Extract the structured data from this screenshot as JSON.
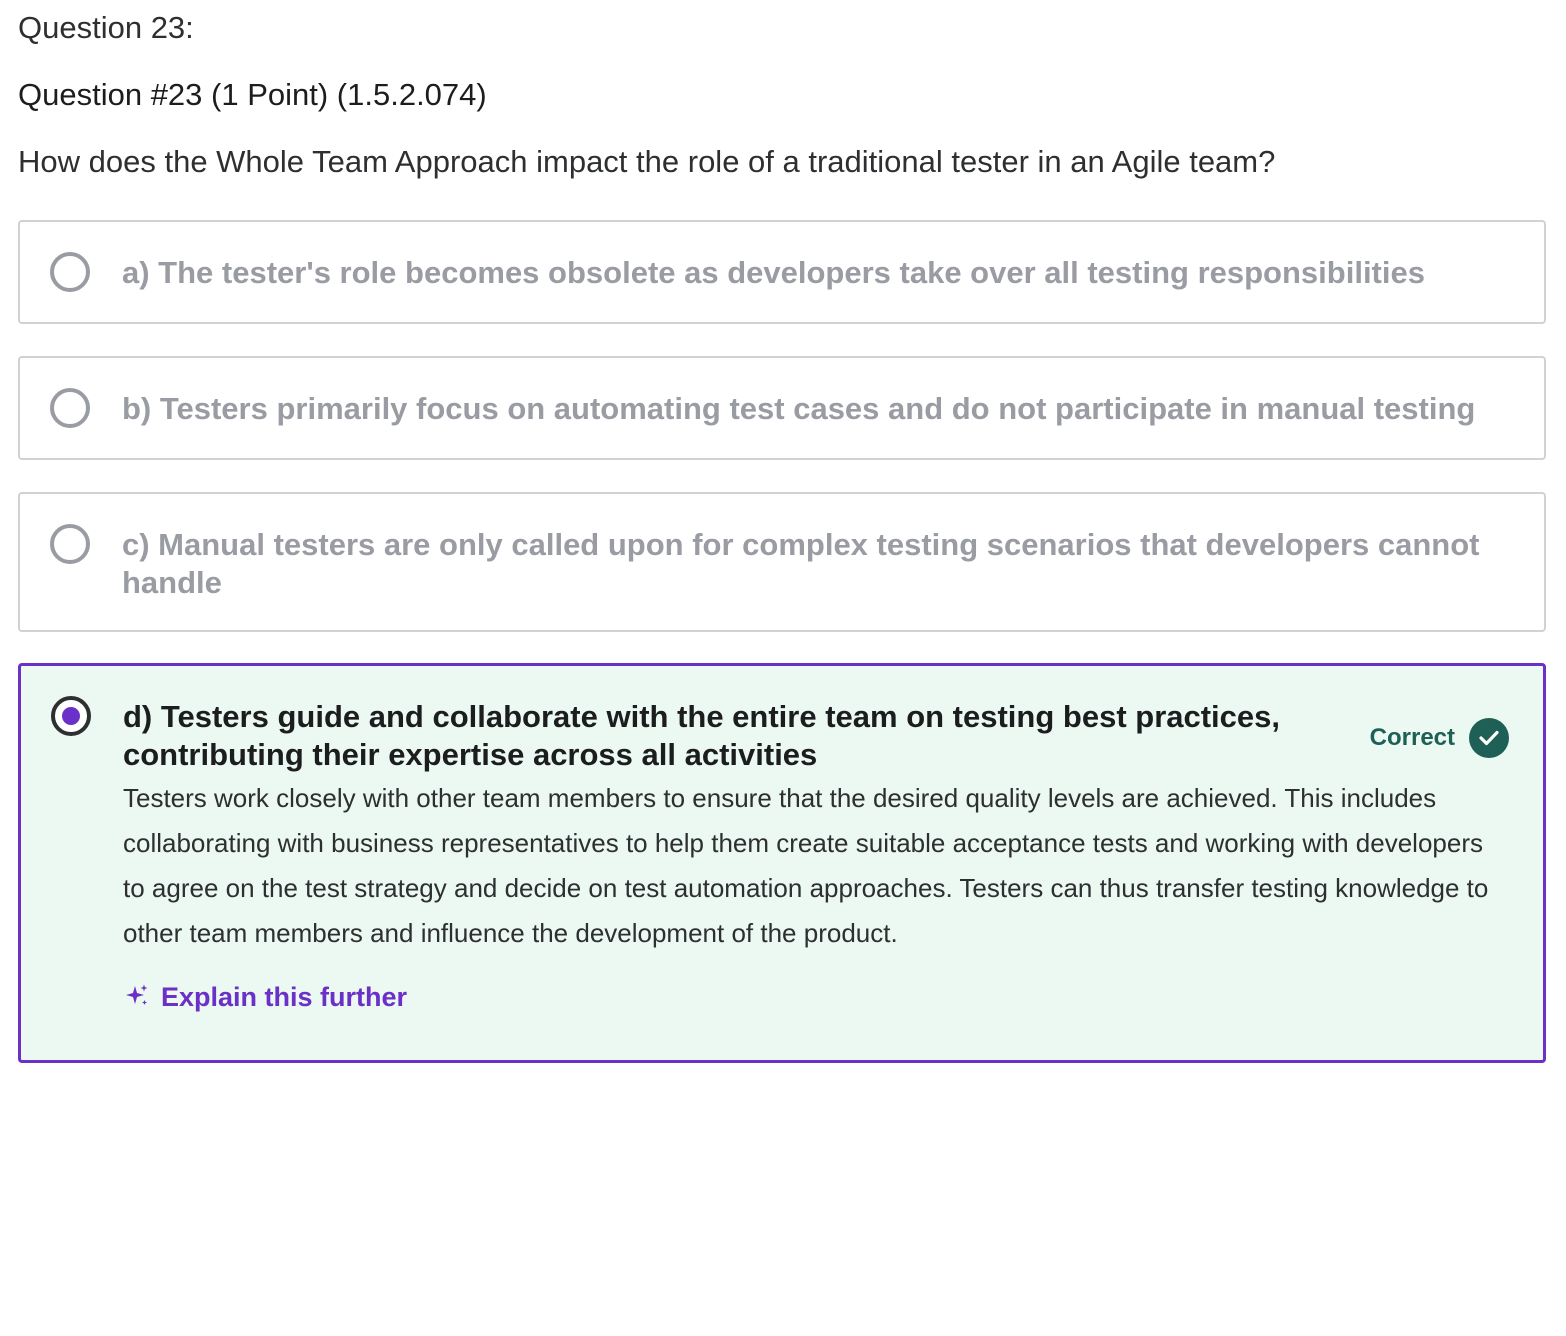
{
  "question": {
    "number_label": "Question 23:",
    "meta": "Question #23 (1 Point) (1.5.2.074)",
    "prompt": "How does the Whole Team Approach impact the role of a traditional tester in an Agile team?"
  },
  "options": [
    {
      "label": "a) The tester's role becomes obsolete as developers take over all testing responsibilities",
      "selected": false
    },
    {
      "label": "b) Testers primarily focus on automating test cases and do not participate in manual testing",
      "selected": false
    },
    {
      "label": "c) Manual testers are only called upon for complex testing scenarios that developers cannot handle",
      "selected": false
    },
    {
      "label": "d) Testers guide and collaborate with the entire team on testing best practices, contributing their expertise across all activities",
      "selected": true,
      "result_label": "Correct",
      "explanation": "Testers work closely with other team members to ensure that the desired quality levels are achieved. This includes collaborating with business representatives to help them create suitable acceptance tests and working with developers to agree on the test strategy and decide on test automation approaches. Testers can thus transfer testing knowledge to other team members and influence the development of the product.",
      "explain_button_label": "Explain this further"
    }
  ],
  "colors": {
    "accent": "#6a30c7",
    "correct": "#1e6055",
    "selected_background": "#ecf8f2",
    "muted_text": "#9a9ca3",
    "border": "#d1d2d4"
  },
  "icons": {
    "correct": "check-circle-icon",
    "explain": "sparkle-icon",
    "radio_unselected": "radio-empty-icon",
    "radio_selected": "radio-filled-icon"
  }
}
